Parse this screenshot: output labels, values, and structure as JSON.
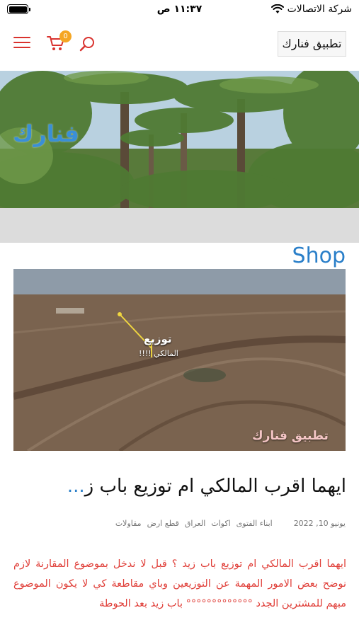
{
  "status_bar": {
    "carrier": "شركة الاتصالات",
    "time": "١١:٣٧ ص"
  },
  "header": {
    "site_title": "تطبيق فنارك",
    "cart_count": "0",
    "icons": {
      "menu": "hamburger-icon",
      "cart": "cart-icon",
      "search": "search-icon"
    },
    "accent_color": "#d9322e"
  },
  "hero": {
    "logo_text": "فنارك"
  },
  "shop_heading": "Shop",
  "article": {
    "image": {
      "caption_title": "توزيع",
      "caption_subtitle": "المالكي !!!!",
      "watermark": "تطبيق فنارك"
    },
    "title": "ايهما اقرب المالكي ام توزيع باب ز",
    "title_ellipsis": "...",
    "date": "يونيو 10, 2022",
    "categories": [
      "ابناء الفتوى",
      "اكوات",
      "العراق",
      "قطع ارض",
      "مقاولات"
    ],
    "excerpt": "ايهما اقرب المالكي ام توزيع باب زيد ؟ قبل لا ندخل بموضوع المقارنة لازم نوضح بعض الامور المهمة عن التوزيعين وباي مقاطعة كي لا يكون الموضوع مبهم للمشترين الجدد °°°°°°°°°°°°° باب زيد بعد الحوطة"
  }
}
